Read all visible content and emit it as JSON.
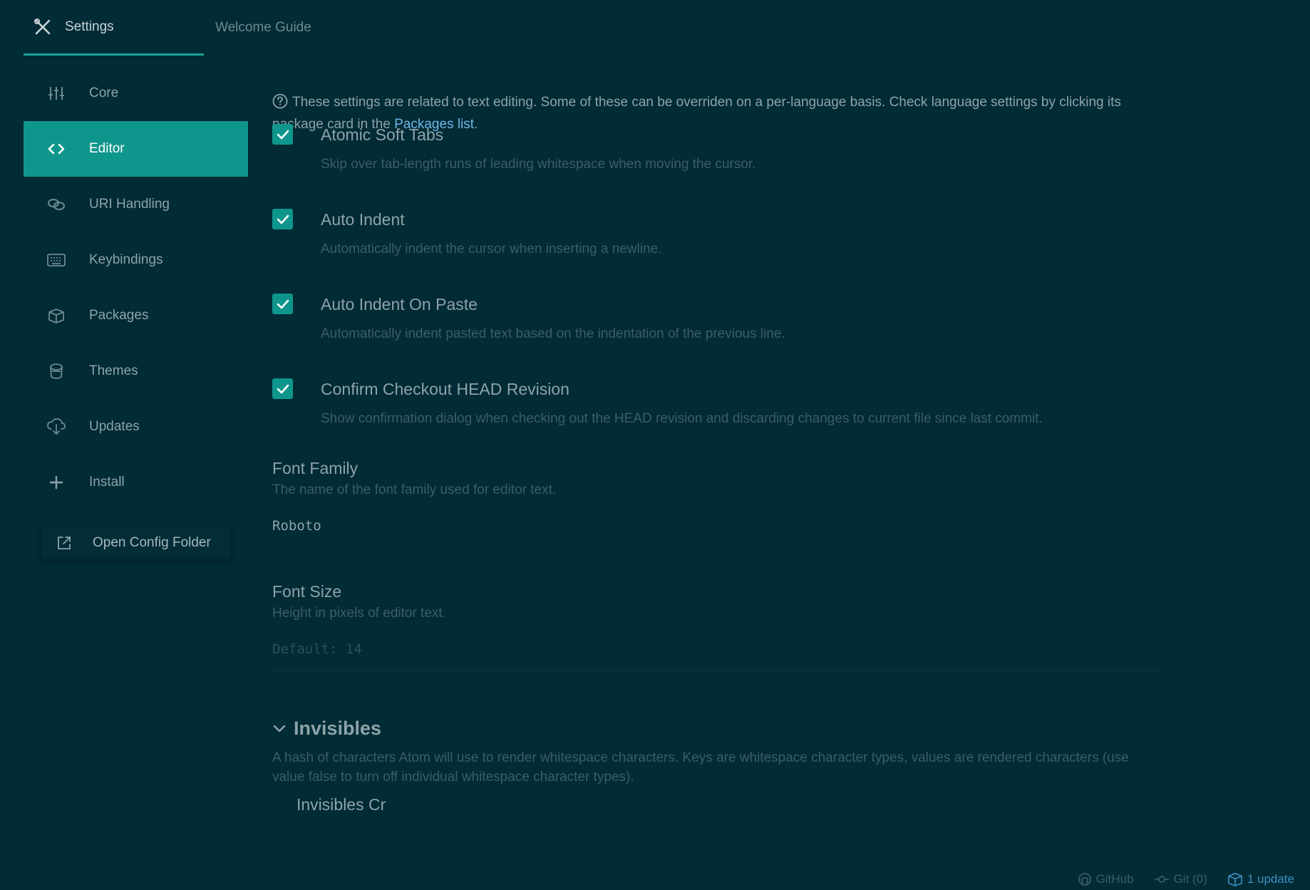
{
  "tabs": [
    {
      "label": "Settings",
      "icon": "tools-icon",
      "active": true
    },
    {
      "label": "Welcome Guide",
      "active": false
    }
  ],
  "sidebar": {
    "items": [
      {
        "label": "Core",
        "icon": "sliders-icon"
      },
      {
        "label": "Editor",
        "icon": "code-icon",
        "active": true
      },
      {
        "label": "URI Handling",
        "icon": "link-icon"
      },
      {
        "label": "Keybindings",
        "icon": "keyboard-icon"
      },
      {
        "label": "Packages",
        "icon": "package-icon"
      },
      {
        "label": "Themes",
        "icon": "paintcan-icon"
      },
      {
        "label": "Updates",
        "icon": "cloud-download-icon"
      },
      {
        "label": "Install",
        "icon": "plus-icon"
      }
    ],
    "open_config_label": "Open Config Folder"
  },
  "main": {
    "intro_text": "These settings are related to text editing. Some of these can be overriden on a per-language basis. Check language settings by clicking its package card in the ",
    "intro_link": "Packages list",
    "intro_end": ".",
    "checkboxes": [
      {
        "title": "Atomic Soft Tabs",
        "desc": "Skip over tab-length runs of leading whitespace when moving the cursor.",
        "checked": true
      },
      {
        "title": "Auto Indent",
        "desc": "Automatically indent the cursor when inserting a newline.",
        "checked": true
      },
      {
        "title": "Auto Indent On Paste",
        "desc": "Automatically indent pasted text based on the indentation of the previous line.",
        "checked": true
      },
      {
        "title": "Confirm Checkout HEAD Revision",
        "desc": "Show confirmation dialog when checking out the HEAD revision and discarding changes to current file since last commit.",
        "checked": true
      }
    ],
    "font_family": {
      "title": "Font Family",
      "desc": "The name of the font family used for editor text.",
      "value": "Roboto"
    },
    "font_size": {
      "title": "Font Size",
      "desc": "Height in pixels of editor text.",
      "placeholder": "Default: 14"
    },
    "invisibles": {
      "title": "Invisibles",
      "desc": "A hash of characters Atom will use to render whitespace characters. Keys are whitespace character types, values are rendered characters (use value false to turn off individual whitespace character types).",
      "sub_title": "Invisibles Cr"
    }
  },
  "statusbar": {
    "github": "GitHub",
    "git": "Git (0)",
    "update": "1 update"
  },
  "colors": {
    "background": "#012b35",
    "accent": "#0f968c",
    "link": "#6fb7e6"
  }
}
